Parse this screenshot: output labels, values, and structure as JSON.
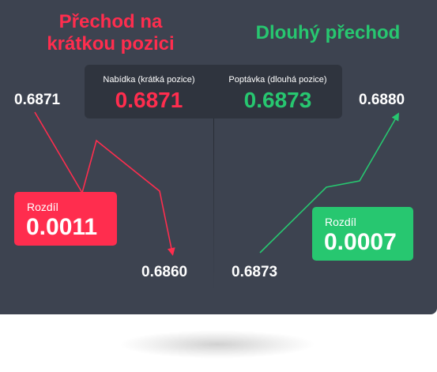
{
  "headings": {
    "short": [
      "Přechod na",
      "krátkou pozici"
    ],
    "long": "Dlouhý přechod"
  },
  "quotes": {
    "bid": {
      "label": "Nabídka (krátká pozice)",
      "value": "0.6871"
    },
    "ask": {
      "label": "Poptávka (dlouhá pozice)",
      "value": "0.6873"
    }
  },
  "short_path": {
    "start_price": "0.6871",
    "end_price": "0.6860",
    "difference_label": "Rozdíl",
    "difference_value": "0.0011"
  },
  "long_path": {
    "start_price": "0.6873",
    "end_price": "0.6880",
    "difference_label": "Rozdíl",
    "difference_value": "0.0007"
  },
  "colors": {
    "panel": "#3d4350",
    "quote_box": "#2f343e",
    "short_red": "#ff2d4e",
    "long_green": "#27c770",
    "text": "#ffffff"
  }
}
